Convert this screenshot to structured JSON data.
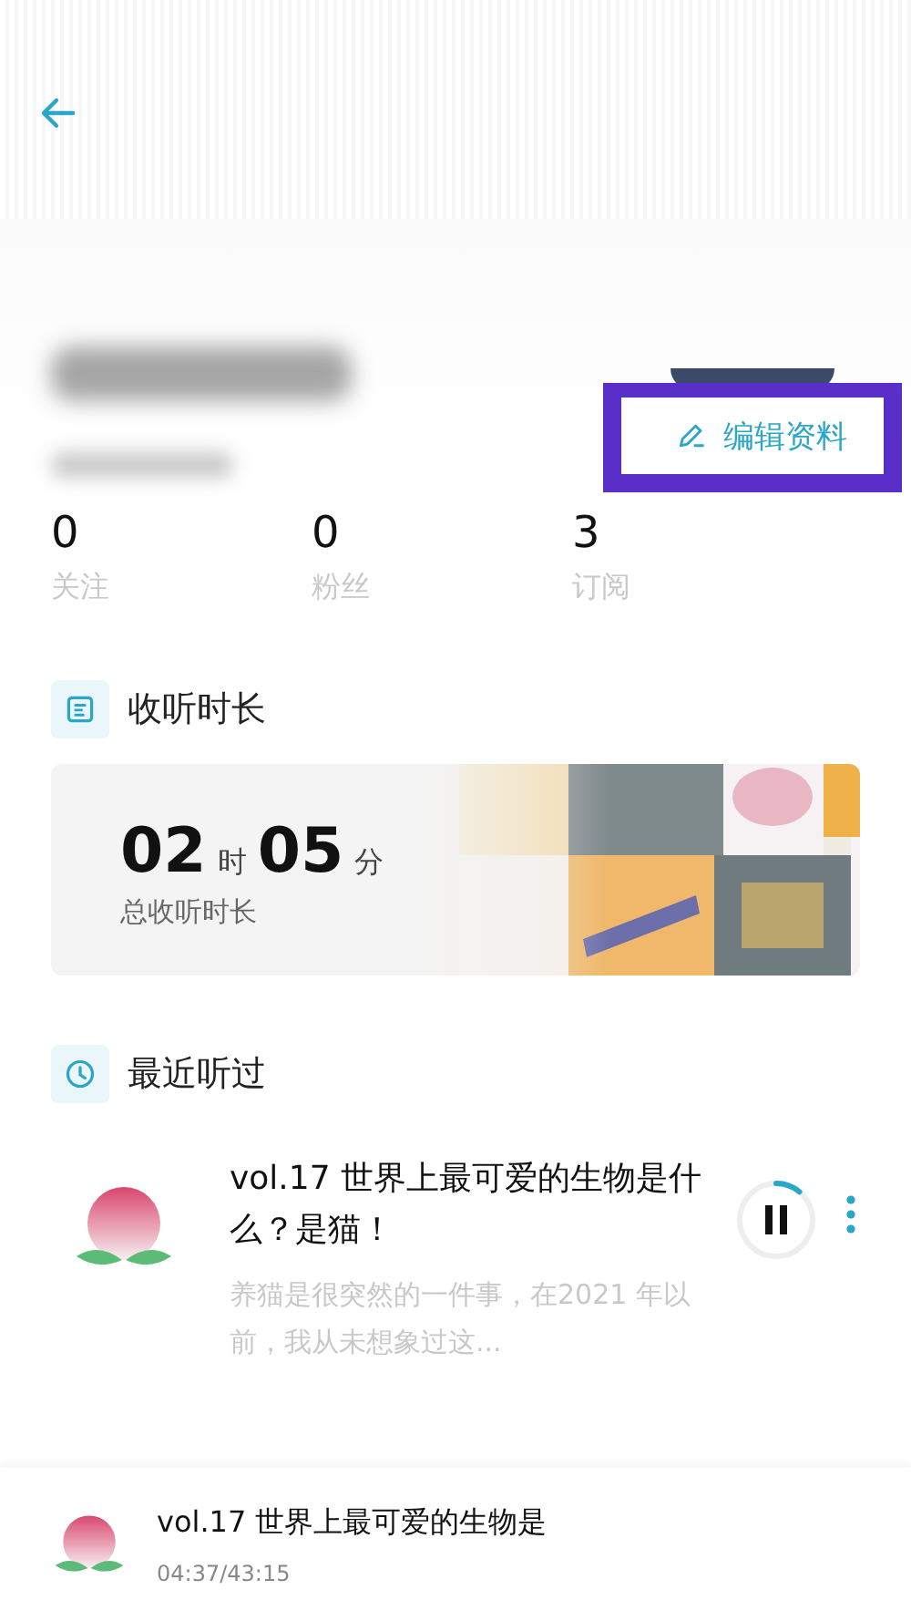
{
  "header": {
    "edit_button": {
      "label": "编辑资料",
      "highlighted": true
    }
  },
  "stats": [
    {
      "value": "0",
      "label": "关注"
    },
    {
      "value": "0",
      "label": "粉丝"
    },
    {
      "value": "3",
      "label": "订阅"
    }
  ],
  "listening": {
    "title": "收听时长",
    "hours": "02",
    "hours_unit": "时",
    "minutes": "05",
    "minutes_unit": "分",
    "caption": "总收听时长"
  },
  "recent": {
    "title": "最近听过",
    "items": [
      {
        "title": "vol.17 世界上最可爱的生物是什么？是猫！",
        "excerpt": "养猫是很突然的一件事，在2021 年以前，我从未想象过这...",
        "playing": true,
        "level": 0.11
      }
    ]
  },
  "mini_player": {
    "title": "vol.17 世界上最可爱的生物是",
    "time": "04:37/43:15"
  }
}
